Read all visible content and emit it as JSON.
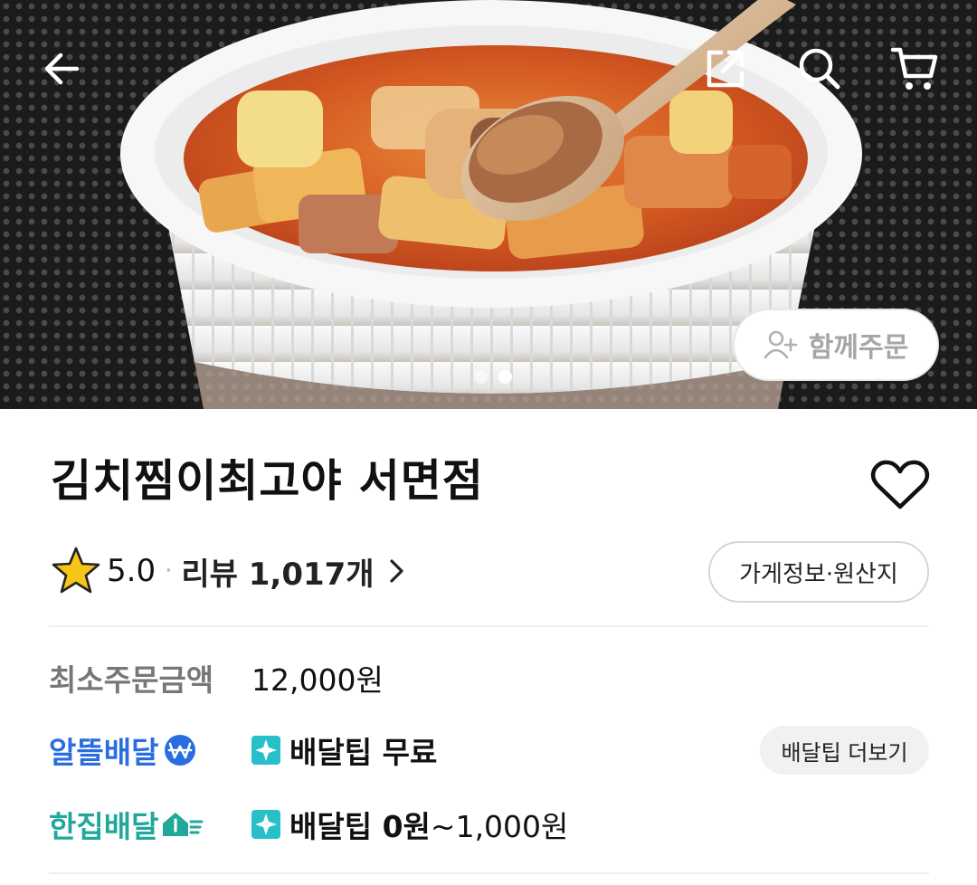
{
  "header": {
    "back_icon": "arrow-left-icon",
    "share_icon": "share-icon",
    "search_icon": "search-icon",
    "cart_icon": "cart-icon"
  },
  "gallery": {
    "current_index": 2,
    "total": 2
  },
  "group_order": {
    "label": "함께주문",
    "icon": "add-person-icon"
  },
  "store": {
    "name": "김치찜이최고야 서면점",
    "favorite_icon": "heart-outline-icon",
    "rating": "5.0",
    "rating_separator": "·",
    "review_label": "리뷰 1,017개",
    "info_button": "가게정보·원산지"
  },
  "min_order": {
    "label": "최소주문금액",
    "value": "12,000원"
  },
  "delivery": [
    {
      "name": "알뜰배달",
      "color": "#2a6de0",
      "badge_icon": "won-coin-icon",
      "tip_label": "배달팁",
      "tip_value": "무료",
      "more_button": "배달팁 더보기"
    },
    {
      "name": "한집배달",
      "color": "#21a89a",
      "badge_icon": "house-speed-icon",
      "tip_label": "배달팁",
      "tip_value_bold": "0원",
      "tip_value_rest": "~1,000원"
    }
  ],
  "colors": {
    "sparkle": "#27c0c9",
    "star": "#f5c518"
  }
}
